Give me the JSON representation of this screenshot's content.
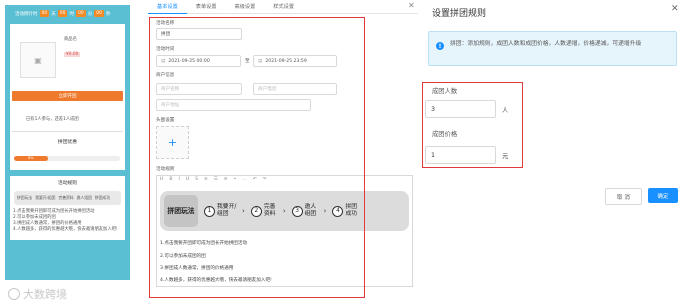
{
  "phone": {
    "timer": {
      "prefix": "活动倒计时",
      "d": "00",
      "h": "00",
      "m": "00",
      "s": "00",
      "unit_d": "天",
      "unit_h": "时",
      "unit_m": "分",
      "unit_s": "秒"
    },
    "product_name": "商品名",
    "price": "¥0.00",
    "join_button": "立即开团",
    "joined_text": "已有1人参与，还差1人成团",
    "group_title": "拼团优惠",
    "progress_label": "8%",
    "rules_title": "活动规则",
    "flow_lead": "拼团玩法",
    "flow_steps": [
      "我要开/组团",
      "完善资料",
      "邀人组团",
      "拼团成功"
    ],
    "rules": [
      "1.点击我要开团即可成为团长开始拼团活动",
      "2.可以参加未成团的团",
      "3.拼团成人数通常，拼团的价格通用",
      "4.人数越多，获得的优惠越大哦，快去邀请朋友加入吧!"
    ]
  },
  "tabs": [
    "基本设置",
    "表单设置",
    "高级设置",
    "样式设置"
  ],
  "form": {
    "activity_name_label": "活动名称",
    "activity_name_value": "拼团",
    "time_label": "活动时间",
    "start_time": "2021-09-25 00:00",
    "end_time": "2021-09-25 23:59",
    "time_sep": "至",
    "owner_label": "商户信息",
    "owner_ph1": "商户名称",
    "owner_ph2": "商户电话",
    "owner_ph3": "商户地址",
    "cover_label": "头图设置",
    "upload_plus": "+",
    "rules_label": "活动规则",
    "toolbar": [
      "H",
      "B",
      "I",
      "U",
      "S",
      "≡",
      "☰",
      "≡",
      "•",
      "…",
      "↶",
      "↷"
    ]
  },
  "flow": {
    "lead": "拼团玩法",
    "steps": [
      {
        "num": "1",
        "text": "我要开/组团"
      },
      {
        "num": "2",
        "text": "完善资料"
      },
      {
        "num": "3",
        "text": "邀人组团"
      },
      {
        "num": "4",
        "text": "拼团成功"
      }
    ]
  },
  "rule_lines": [
    "1.点击我要开团即可成为团长开始拼团活动",
    "2.可以参加未成团的团",
    "3.拼团成人数通常，拼团的价格通用",
    "4.人数越多，获得的优惠越大哦，快去邀请朋友加入吧!"
  ],
  "panel": {
    "title": "设置拼团规则",
    "close": "✕",
    "info_icon": "!",
    "info_text": "拼团：添加规则，成团人数和成团价格，人数递增，价格递减，可递增升级",
    "size_label": "成团人数",
    "size_value": "3",
    "size_unit": "人",
    "price_label": "成团价格",
    "price_value": "1",
    "price_unit": "元",
    "cancel": "取 消",
    "confirm": "确定"
  },
  "watermark": "大数跨境",
  "colors": {
    "accent": "#1890ff",
    "highlight": "#e23a3a",
    "phone_bg": "#5bbfd3",
    "orange": "#ef7a2d"
  },
  "progress": {
    "group_fill_fraction": 0.32
  }
}
